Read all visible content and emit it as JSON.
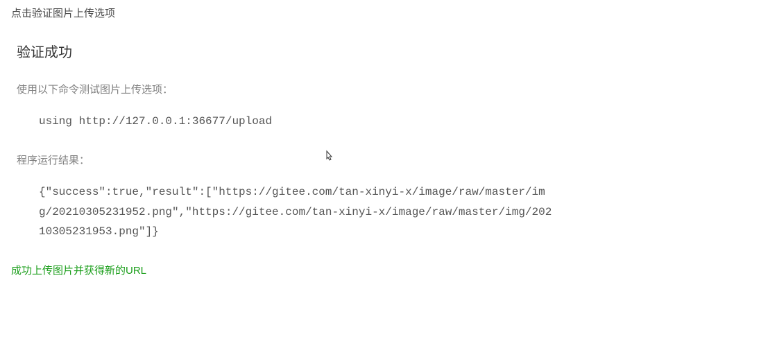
{
  "intro": "点击验证图片上传选项",
  "heading": "验证成功",
  "test_label": "使用以下命令测试图片上传选项：",
  "test_command": "using http://127.0.0.1:36677/upload",
  "result_label": "程序运行结果：",
  "result_output": "{\"success\":true,\"result\":[\"https://gitee.com/tan-xinyi-x/image/raw/master/img/20210305231952.png\",\"https://gitee.com/tan-xinyi-x/image/raw/master/img/20210305231953.png\"]}",
  "success_message": "成功上传图片并获得新的URL"
}
